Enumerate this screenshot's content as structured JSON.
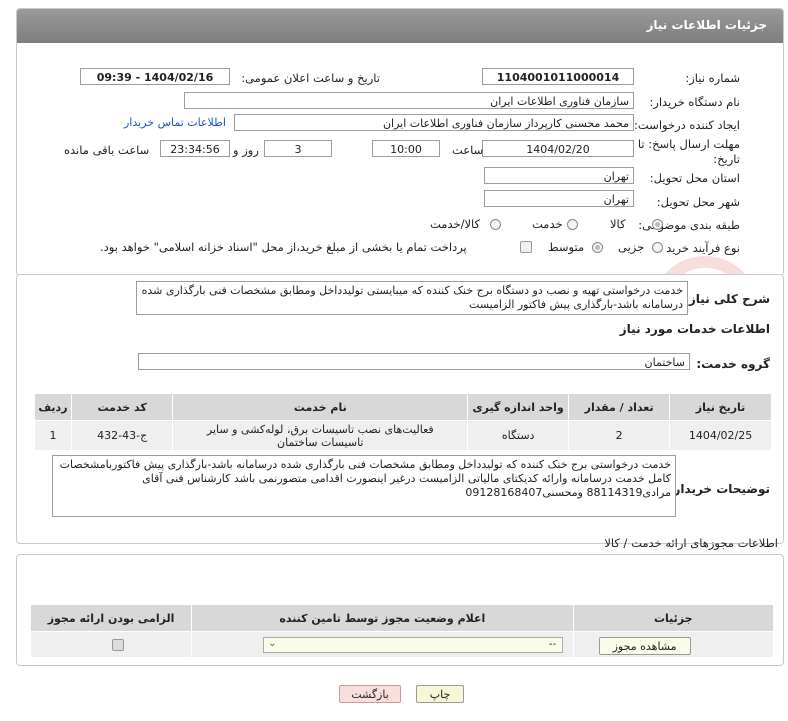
{
  "header": {
    "title": "جزئیات اطلاعات نیاز"
  },
  "need": {
    "number_label": "شماره نیاز:",
    "number": "1104001011000014",
    "announce_label": "تاریخ و ساعت اعلان عمومی:",
    "announce": "1404/02/16 - 09:39",
    "buyer_label": "نام دستگاه خریدار:",
    "buyer": "سازمان فناوری اطلاعات ایران",
    "creator_label": "ایجاد کننده درخواست:",
    "creator": "محمد محسنی کارپرداز سازمان فناوری اطلاعات ایران",
    "contact_link": "اطلاعات تماس خریدار",
    "deadline_label_1": "مهلت ارسال پاسخ: تا",
    "deadline_label_2": "تاریخ:",
    "deadline_date": "1404/02/20",
    "time_label": "ساعت",
    "deadline_time": "10:00",
    "days": "3",
    "days_label": "روز و",
    "remaining": "23:34:56",
    "remaining_label": "ساعت باقی مانده",
    "province_label": "استان محل تحویل:",
    "province": "تهران",
    "city_label": "شهر محل تحویل:",
    "city": "تهران",
    "category_label": "طبقه بندی موضوعی:",
    "cat_goods": "کالا",
    "cat_service": "خدمت",
    "cat_both": "کالا/خدمت",
    "process_label": "نوع فرآیند خرید :",
    "proc_minor": "جزیی",
    "proc_medium": "متوسط",
    "payment_note": "پرداخت تمام یا بخشی از مبلغ خرید،از محل \"اسناد خزانه اسلامی\" خواهد بود."
  },
  "description": {
    "label": "شرح کلی نیاز:",
    "text": "خدمت درخواستی تهیه و نصب دو دستگاه برج خنک کننده که میبایستی تولیدداخل ومطابق مشخصات فنی بارگذاری شده درسامانه باشد-بارگذاری پیش فاکتور الزامیست"
  },
  "services": {
    "title": "اطلاعات خدمات مورد نیاز",
    "group_label": "گروه خدمت:",
    "group": "ساختمان",
    "columns": [
      "ردیف",
      "کد خدمت",
      "نام خدمت",
      "واحد اندازه گیری",
      "تعداد / مقدار",
      "تاریخ نیاز"
    ],
    "rows": [
      {
        "row": "1",
        "code": "ج-43-432",
        "name": "فعالیت‌های نصب تاسیسات برق، لوله‌کشی و سایر تاسیسات ساختمان",
        "unit": "دستگاه",
        "qty": "2",
        "date": "1404/02/25"
      }
    ]
  },
  "buyer_notes": {
    "label": "توضیحات خریدار:",
    "text": "خدمت درخواستی برج خنک کننده که تولیدداخل ومطابق مشخصات فنی بارگذاری شده درسامانه باشد-بارگذاری پیش فاکتوربامشخصات کامل خدمت درسامانه وارائه کدیکتای مالیاتی الزامیست درغیر اینصورت اقدامی متصورنمی باشد کارشناس فنی آقای مرادی88114319 ومحسنی09128168407"
  },
  "permits": {
    "title": "اطلاعات مجوزهای ارائه خدمت / کالا",
    "columns": [
      "الزامی بودن ارائه مجوز",
      "اعلام وضعیت مجوز توسط تامین کننده",
      "جزئیات"
    ],
    "select_value": "--",
    "view_button": "مشاهده مجوز"
  },
  "footer": {
    "print": "چاپ",
    "back": "بازگشت"
  }
}
